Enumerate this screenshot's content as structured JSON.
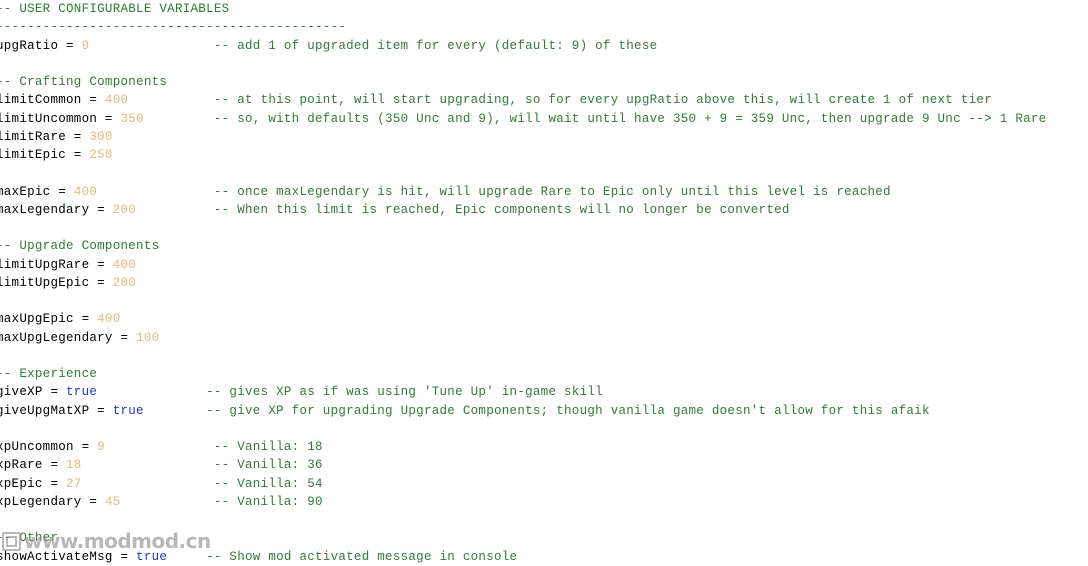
{
  "document": {
    "language": "lua",
    "background_color": "#ffffff",
    "comment_color": "#2e7d32",
    "number_color": "#e8b87a",
    "keyword_color": "#1a3ad6",
    "identifier_color": "#000000"
  },
  "watermark": {
    "text": "www.modmod.cn",
    "icon": "square-badge-icon",
    "color": "#8d8d8d"
  },
  "lines": [
    {
      "indent": 0,
      "tokens": [
        {
          "t": "comment",
          "v": "-- USER CONFIGURABLE VARIABLES"
        }
      ]
    },
    {
      "indent": 0,
      "tokens": [
        {
          "t": "comment",
          "v": "---------------------------------------------"
        }
      ]
    },
    {
      "indent": 0,
      "tokens": [
        {
          "t": "var",
          "v": "upgRatio"
        },
        {
          "t": "op",
          "v": " = "
        },
        {
          "t": "num",
          "v": "9"
        },
        {
          "t": "pad",
          "v": "                "
        },
        {
          "t": "comment",
          "v": "-- add 1 of upgraded item for every (default: 9) of these"
        }
      ]
    },
    {
      "indent": 0,
      "tokens": []
    },
    {
      "indent": 0,
      "tokens": [
        {
          "t": "comment",
          "v": "-- Crafting Components"
        }
      ]
    },
    {
      "indent": 0,
      "tokens": [
        {
          "t": "var",
          "v": "limitCommon"
        },
        {
          "t": "op",
          "v": " = "
        },
        {
          "t": "num",
          "v": "400"
        },
        {
          "t": "pad",
          "v": "           "
        },
        {
          "t": "comment",
          "v": "-- at this point, will start upgrading, so for every upgRatio above this, will create 1 of next tier"
        }
      ]
    },
    {
      "indent": 0,
      "tokens": [
        {
          "t": "var",
          "v": "limitUncommon"
        },
        {
          "t": "op",
          "v": " = "
        },
        {
          "t": "num",
          "v": "350"
        },
        {
          "t": "pad",
          "v": "         "
        },
        {
          "t": "comment",
          "v": "-- so, with defaults (350 Unc and 9), will wait until have 350 + 9 = 359 Unc, then upgrade 9 Unc --> 1 Rare"
        }
      ]
    },
    {
      "indent": 0,
      "tokens": [
        {
          "t": "var",
          "v": "limitRare"
        },
        {
          "t": "op",
          "v": " = "
        },
        {
          "t": "num",
          "v": "300"
        }
      ]
    },
    {
      "indent": 0,
      "tokens": [
        {
          "t": "var",
          "v": "limitEpic"
        },
        {
          "t": "op",
          "v": " = "
        },
        {
          "t": "num",
          "v": "250"
        }
      ]
    },
    {
      "indent": 0,
      "tokens": []
    },
    {
      "indent": 0,
      "tokens": [
        {
          "t": "var",
          "v": "maxEpic"
        },
        {
          "t": "op",
          "v": " = "
        },
        {
          "t": "num",
          "v": "400"
        },
        {
          "t": "pad",
          "v": "               "
        },
        {
          "t": "comment",
          "v": "-- once maxLegendary is hit, will upgrade Rare to Epic only until this level is reached"
        }
      ]
    },
    {
      "indent": 0,
      "tokens": [
        {
          "t": "var",
          "v": "maxLegendary"
        },
        {
          "t": "op",
          "v": " = "
        },
        {
          "t": "num",
          "v": "200"
        },
        {
          "t": "pad",
          "v": "          "
        },
        {
          "t": "comment",
          "v": "-- When this limit is reached, Epic components will no longer be converted"
        }
      ]
    },
    {
      "indent": 0,
      "tokens": []
    },
    {
      "indent": 0,
      "tokens": [
        {
          "t": "comment",
          "v": "-- Upgrade Components"
        }
      ]
    },
    {
      "indent": 0,
      "tokens": [
        {
          "t": "var",
          "v": "limitUpgRare"
        },
        {
          "t": "op",
          "v": " = "
        },
        {
          "t": "num",
          "v": "400"
        }
      ]
    },
    {
      "indent": 0,
      "tokens": [
        {
          "t": "var",
          "v": "limitUpgEpic"
        },
        {
          "t": "op",
          "v": " = "
        },
        {
          "t": "num",
          "v": "200"
        }
      ]
    },
    {
      "indent": 0,
      "tokens": []
    },
    {
      "indent": 0,
      "tokens": [
        {
          "t": "var",
          "v": "maxUpgEpic"
        },
        {
          "t": "op",
          "v": " = "
        },
        {
          "t": "num",
          "v": "400"
        }
      ]
    },
    {
      "indent": 0,
      "tokens": [
        {
          "t": "var",
          "v": "maxUpgLegendary"
        },
        {
          "t": "op",
          "v": " = "
        },
        {
          "t": "num",
          "v": "100"
        }
      ]
    },
    {
      "indent": 0,
      "tokens": []
    },
    {
      "indent": 0,
      "tokens": [
        {
          "t": "comment",
          "v": "-- Experience"
        }
      ]
    },
    {
      "indent": 0,
      "tokens": [
        {
          "t": "var",
          "v": "giveXP"
        },
        {
          "t": "op",
          "v": " = "
        },
        {
          "t": "kw",
          "v": "true"
        },
        {
          "t": "pad",
          "v": "              "
        },
        {
          "t": "comment",
          "v": "-- gives XP as if was using 'Tune Up' in-game skill"
        }
      ]
    },
    {
      "indent": 0,
      "tokens": [
        {
          "t": "var",
          "v": "giveUpgMatXP"
        },
        {
          "t": "op",
          "v": " = "
        },
        {
          "t": "kw",
          "v": "true"
        },
        {
          "t": "pad",
          "v": "        "
        },
        {
          "t": "comment",
          "v": "-- give XP for upgrading Upgrade Components; though vanilla game doesn't allow for this afaik"
        }
      ]
    },
    {
      "indent": 0,
      "tokens": []
    },
    {
      "indent": 0,
      "tokens": [
        {
          "t": "var",
          "v": "xpUncommon"
        },
        {
          "t": "op",
          "v": " = "
        },
        {
          "t": "num",
          "v": "9"
        },
        {
          "t": "pad",
          "v": "              "
        },
        {
          "t": "comment",
          "v": "-- Vanilla: 18"
        }
      ]
    },
    {
      "indent": 0,
      "tokens": [
        {
          "t": "var",
          "v": "xpRare"
        },
        {
          "t": "op",
          "v": " = "
        },
        {
          "t": "num",
          "v": "18"
        },
        {
          "t": "pad",
          "v": "                 "
        },
        {
          "t": "comment",
          "v": "-- Vanilla: 36"
        }
      ]
    },
    {
      "indent": 0,
      "tokens": [
        {
          "t": "var",
          "v": "xpEpic"
        },
        {
          "t": "op",
          "v": " = "
        },
        {
          "t": "num",
          "v": "27"
        },
        {
          "t": "pad",
          "v": "                 "
        },
        {
          "t": "comment",
          "v": "-- Vanilla: 54"
        }
      ]
    },
    {
      "indent": 0,
      "tokens": [
        {
          "t": "var",
          "v": "xpLegendary"
        },
        {
          "t": "op",
          "v": " = "
        },
        {
          "t": "num",
          "v": "45"
        },
        {
          "t": "pad",
          "v": "            "
        },
        {
          "t": "comment",
          "v": "-- Vanilla: 90"
        }
      ]
    },
    {
      "indent": 0,
      "tokens": []
    },
    {
      "indent": 0,
      "tokens": [
        {
          "t": "comment",
          "v": "-- Other"
        }
      ]
    },
    {
      "indent": 0,
      "tokens": [
        {
          "t": "var",
          "v": "showActivateMsg"
        },
        {
          "t": "op",
          "v": " = "
        },
        {
          "t": "kw",
          "v": "true"
        },
        {
          "t": "pad",
          "v": "     "
        },
        {
          "t": "comment",
          "v": "-- Show mod activated message in console"
        }
      ]
    }
  ]
}
